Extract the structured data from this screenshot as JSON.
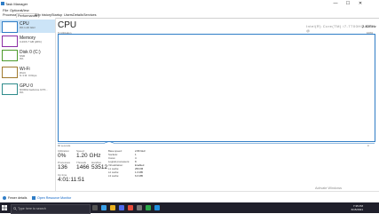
{
  "window": {
    "title": "Task Manager",
    "min": "—",
    "max": "☐",
    "close": "✕"
  },
  "menu": [
    "File",
    "Options",
    "View"
  ],
  "tabs": [
    "Processes",
    "Performance",
    "App history",
    "Startup",
    "Users",
    "Details",
    "Services"
  ],
  "active_tab": "Performance",
  "sidebar": [
    {
      "name": "CPU",
      "sub": "0% 1.20 GHz",
      "color": "#2f7dc6"
    },
    {
      "name": "Memory",
      "sub": "3.2/15.7 GB (20%)",
      "color": "#8b2ea5"
    },
    {
      "name": "Disk 0 (C:)",
      "sub": "SSD\n0%",
      "color": "#4c9a2a"
    },
    {
      "name": "Wi-Fi",
      "sub": "Wi-Fi\nS: 0 R: 0 Kbps",
      "color": "#a07a2e"
    },
    {
      "name": "GPU 0",
      "sub": "NVIDIA GeForce GTX...\n0%",
      "color": "#2e8b8b"
    }
  ],
  "cpu": {
    "heading": "CPU",
    "model": "Intel(R) Core(TM) i7-7700HQ CPU @",
    "freq": "2.80GHz",
    "util_label": "% Utilization",
    "util_max": "100%",
    "window_label": "60 seconds",
    "zero": "0"
  },
  "stats": {
    "utilization_label": "Utilization",
    "utilization": "0%",
    "speed_label": "Speed",
    "speed": "1.20 GHz",
    "processes_label": "Processes",
    "processes": "136",
    "threads_label": "Threads",
    "threads": "1466",
    "handles_label": "Handles",
    "handles": "53512",
    "uptime_label": "Up time",
    "uptime": "4:01:11:51"
  },
  "specs": [
    {
      "label": "Base speed:",
      "value": "2.80 GHz"
    },
    {
      "label": "Sockets:",
      "value": "1"
    },
    {
      "label": "Cores:",
      "value": "4"
    },
    {
      "label": "Logical processors:",
      "value": "8"
    },
    {
      "label": "Virtualization:",
      "value": "Enabled"
    },
    {
      "label": "L1 cache:",
      "value": "256 KB"
    },
    {
      "label": "L2 cache:",
      "value": "1.0 MB"
    },
    {
      "label": "L3 cache:",
      "value": "6.0 MB"
    }
  ],
  "footer": {
    "fewer": "Fewer details",
    "monitor": "Open Resource Monitor"
  },
  "watermark": {
    "title": "Activate Windows",
    "sub": "Go to Settings to activate Windows."
  },
  "taskbar": {
    "search": "Type here to search",
    "time": "7:35 PM",
    "date": "6/15/2021"
  },
  "colors": {
    "accent": "#2f7dc6",
    "selected": "#cce4f7",
    "taskbar": "#1f1f2b"
  }
}
